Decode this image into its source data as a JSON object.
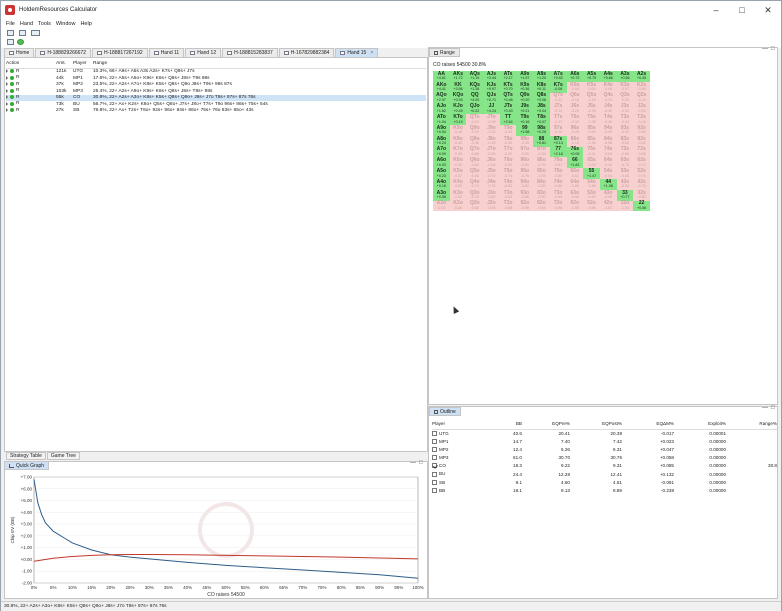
{
  "window": {
    "title": "HoldemResources Calculator"
  },
  "menu": [
    "File",
    "Hand",
    "Tools",
    "Window",
    "Help"
  ],
  "tabs": [
    {
      "label": "Home",
      "active": false
    },
    {
      "label": "H-188829266672",
      "active": false
    },
    {
      "label": "H-188817267192",
      "active": false
    },
    {
      "label": "Hand 11",
      "active": false
    },
    {
      "label": "Hand 12",
      "active": false
    },
    {
      "label": "H-188815283837",
      "active": false
    },
    {
      "label": "H-167829882384",
      "active": false
    },
    {
      "label": "Hand 15",
      "active": true
    }
  ],
  "hand_table": {
    "headers": [
      "Action",
      "Amt.",
      "Player",
      "Range"
    ],
    "rows": [
      {
        "action": "R",
        "amt": "121k",
        "player": "UTG",
        "range": "10.3%, 66+ A9s+ A5s A3s A2s+ K7s+ Q9s+ J7s",
        "selected": false
      },
      {
        "action": "R",
        "amt": "44k",
        "player": "MP1",
        "range": "17.6%, 22+ A5s+ A5o+ K9s+ K6s+ Q8s+ J8s+ T9s 88s",
        "selected": false
      },
      {
        "action": "R",
        "amt": "37k",
        "player": "MP2",
        "range": "23.5%, 22+ A2s+ A7o+ K8s+ K5s+ Q8s+ Q9o J8s+ T9s+ 98s 87s",
        "selected": false
      },
      {
        "action": "R",
        "amt": "103k",
        "player": "MP3",
        "range": "25.4%, 22+ A2s+ A9o+ K9s+ K6s+ Q8s+ J8s+ T8s+ 98s",
        "selected": false
      },
      {
        "action": "R",
        "amt": "55k",
        "player": "CO",
        "range": "30.8%, 22+ A2s+ A3o+ K8s+ K5s+ Q8s+ Q9o+ J8s+ J7o T8s+ 97s+ 87s 76s",
        "selected": true
      },
      {
        "action": "R",
        "amt": "73k",
        "player": "BU",
        "range": "56.7%, 22+ Ax+ K2s+ K8o+ Q5s+ Q8o+ J7s+ J8o+ T7s+ T9o 96s+ 86s+ 75s+ 54s",
        "selected": false
      },
      {
        "action": "R",
        "amt": "27k",
        "player": "SB",
        "range": "76.8%, 22+ Ax+ T2s+ T6o+ 92s+ 96o+ 84s+ 86o+ 75s+ 76o 63s+ 65o+ 43s",
        "selected": false
      }
    ]
  },
  "bottom_tabs": [
    "Strategy Table",
    "Game Tree"
  ],
  "quick_graph": {
    "title": "Quick Graph",
    "xlabel": "CO raises 54500",
    "ylabel": "Chip EV (BB)"
  },
  "chart_data": {
    "type": "line",
    "title": "",
    "xlabel": "CO raises 54500",
    "ylabel": "Chip EV (BB)",
    "x_ticks": [
      "0%",
      "5%",
      "10%",
      "15%",
      "20%",
      "25%",
      "30%",
      "35%",
      "40%",
      "45%",
      "50%",
      "55%",
      "60%",
      "65%",
      "70%",
      "75%",
      "80%",
      "85%",
      "90%",
      "95%",
      "100%"
    ],
    "y_ticks": [
      "+7.00",
      "+6.00",
      "+5.00",
      "+4.00",
      "+3.00",
      "+2.00",
      "+1.00",
      "+0.00",
      "-1.00",
      "-2.00"
    ],
    "ylim": [
      -2,
      7
    ],
    "series": [
      {
        "name": "",
        "color": "#2e5d88",
        "x": [
          0,
          1,
          2,
          3,
          5,
          8,
          10,
          15,
          20,
          25,
          30,
          40,
          50,
          60,
          70,
          80,
          90,
          95,
          100
        ],
        "y": [
          6.8,
          4.8,
          3.8,
          3.1,
          2.4,
          1.8,
          1.4,
          0.8,
          0.4,
          0.2,
          0.05,
          -0.25,
          -0.5,
          -0.7,
          -0.9,
          -1.1,
          -1.3,
          -1.45,
          -1.6
        ]
      },
      {
        "name": "",
        "color": "#c0392b",
        "x": [
          0,
          5,
          10,
          15,
          20,
          25,
          30,
          40,
          50,
          60,
          70,
          80,
          90,
          100
        ],
        "y": [
          -0.15,
          0.1,
          0.25,
          0.35,
          0.4,
          0.42,
          0.42,
          0.4,
          0.35,
          0.3,
          0.25,
          0.2,
          0.12,
          0.05
        ]
      }
    ],
    "grid": true
  },
  "range_panel": {
    "title": "Range",
    "subtitle": "CO raises 54500 30.8%"
  },
  "range_grid": [
    [
      "AA",
      "+4.61",
      1
    ],
    [
      "AKs",
      "+1.72",
      1
    ],
    [
      "AQs",
      "+1.19",
      1
    ],
    [
      "AJs",
      "+2.44",
      1
    ],
    [
      "ATs",
      "+2.17",
      1
    ],
    [
      "A9s",
      "+1.57",
      1
    ],
    [
      "A8s",
      "+1.20",
      1
    ],
    [
      "A7s",
      "+0.92",
      1
    ],
    [
      "A6s",
      "+0.73",
      1
    ],
    [
      "A5s",
      "+0.79",
      1
    ],
    [
      "A4s",
      "+0.66",
      1
    ],
    [
      "A3s",
      "+0.56",
      1
    ],
    [
      "A2s",
      "+0.45",
      1
    ],
    [
      "AKo",
      "+4.41",
      1
    ],
    [
      "KK",
      "+3.56",
      1
    ],
    [
      "KQs",
      "+1.36",
      1
    ],
    [
      "KJs",
      "+0.97",
      1
    ],
    [
      "KTs",
      "+0.70",
      1
    ],
    [
      "K9s",
      "+0.36",
      1
    ],
    [
      "K8s",
      "+0.11",
      1
    ],
    [
      "K7s",
      "-0.08",
      1
    ],
    [
      "K6s",
      "-0.04",
      0
    ],
    [
      "K5s",
      "-0.04",
      0
    ],
    [
      "K4s",
      "-0.06",
      0
    ],
    [
      "K3s",
      "-0.07",
      0
    ],
    [
      "K2s",
      "-0.08",
      0
    ],
    [
      "AQo",
      "+2.97",
      1
    ],
    [
      "KQo",
      "+0.93",
      1
    ],
    [
      "QQ",
      "+4.00",
      1
    ],
    [
      "QJs",
      "+0.71",
      1
    ],
    [
      "QTs",
      "+0.46",
      1
    ],
    [
      "Q9s",
      "+0.20",
      1
    ],
    [
      "Q8s",
      "+0.06",
      1
    ],
    [
      "Q7s",
      "-0.12",
      0
    ],
    [
      "Q6s",
      "-0.16",
      0
    ],
    [
      "Q5s",
      "-0.18",
      0
    ],
    [
      "Q4s",
      "-0.20",
      0
    ],
    [
      "Q3s",
      "-0.22",
      0
    ],
    [
      "Q2s",
      "-0.24",
      0
    ],
    [
      "AJo",
      "+1.62",
      1
    ],
    [
      "KJo",
      "+0.49",
      1
    ],
    [
      "QJo",
      "+0.22",
      1
    ],
    [
      "JJ",
      "+4.24",
      1
    ],
    [
      "JTs",
      "+0.43",
      1
    ],
    [
      "J9s",
      "+0.21",
      1
    ],
    [
      "J8s",
      "+0.04",
      1
    ],
    [
      "J7s",
      "-0.14",
      0
    ],
    [
      "J6s",
      "-0.25",
      0
    ],
    [
      "J5s",
      "-0.28",
      0
    ],
    [
      "J4s",
      "-0.30",
      0
    ],
    [
      "J3s",
      "-0.31",
      0
    ],
    [
      "J2s",
      "-0.33",
      0
    ],
    [
      "ATo",
      "+1.04",
      1
    ],
    [
      "KTo",
      "+0.19",
      1
    ],
    [
      "QTo",
      "-0.03",
      0
    ],
    [
      "JTo",
      "-0.08",
      0
    ],
    [
      "TT",
      "+2.64",
      1
    ],
    [
      "T9s",
      "+0.16",
      1
    ],
    [
      "T8s",
      "+0.07",
      1
    ],
    [
      "T7s",
      "-0.17",
      0
    ],
    [
      "T6s",
      "-0.30",
      0
    ],
    [
      "T5s",
      "-0.38",
      0
    ],
    [
      "T4s",
      "-0.40",
      0
    ],
    [
      "T3s",
      "-0.42",
      0
    ],
    [
      "T2s",
      "-0.44",
      0
    ],
    [
      "A9o",
      "+0.54",
      1
    ],
    [
      "K9o",
      "-0.18",
      0
    ],
    [
      "Q9o",
      "-0.29",
      0
    ],
    [
      "J9o",
      "-0.32",
      0
    ],
    [
      "T9o",
      "-0.34",
      0
    ],
    [
      "99",
      "+1.58",
      1
    ],
    [
      "98s",
      "+0.25",
      1
    ],
    [
      "97s",
      "-0.10",
      0
    ],
    [
      "96s",
      "-0.28",
      0
    ],
    [
      "95s",
      "-0.46",
      0
    ],
    [
      "94s",
      "-0.50",
      0
    ],
    [
      "93s",
      "-0.53",
      0
    ],
    [
      "92s",
      "-0.56",
      0
    ],
    [
      "A8o",
      "+0.24",
      1
    ],
    [
      "K8o",
      "-0.40",
      0
    ],
    [
      "Q8o",
      "-0.46",
      0
    ],
    [
      "J8o",
      "-0.48",
      0
    ],
    [
      "T8o",
      "-0.40",
      0
    ],
    [
      "98o",
      "-0.40",
      0
    ],
    [
      "88",
      "+0.81",
      1
    ],
    [
      "87s",
      "+0.14",
      1
    ],
    [
      "86s",
      "-0.19",
      0
    ],
    [
      "85s",
      "-0.36",
      0
    ],
    [
      "84s",
      "-0.58",
      0
    ],
    [
      "83s",
      "-0.60",
      0
    ],
    [
      "82s",
      "-0.62",
      0
    ],
    [
      "A7o",
      "+0.09",
      1
    ],
    [
      "K7o",
      "-0.45",
      0
    ],
    [
      "Q7o",
      "-0.56",
      0
    ],
    [
      "J7o",
      "-0.56",
      0
    ],
    [
      "T7o",
      "-0.52",
      0
    ],
    [
      "97o",
      "-0.50",
      0
    ],
    [
      "87o",
      "-0.58",
      0
    ],
    [
      "77",
      "+2.18",
      1
    ],
    [
      "76s",
      "+0.05",
      1
    ],
    [
      "75s",
      "-0.31",
      0
    ],
    [
      "74s",
      "-0.64",
      0
    ],
    [
      "73s",
      "-0.66",
      0
    ],
    [
      "72s",
      "-0.68",
      0
    ],
    [
      "A6o",
      "+0.03",
      1
    ],
    [
      "K6o",
      "-0.52",
      0
    ],
    [
      "Q6o",
      "-0.62",
      0
    ],
    [
      "J6o",
      "-0.64",
      0
    ],
    [
      "T6o",
      "-0.62",
      0
    ],
    [
      "96o",
      "-0.60",
      0
    ],
    [
      "86o",
      "-0.70",
      0
    ],
    [
      "76o",
      "-0.67",
      0
    ],
    [
      "66",
      "+1.82",
      1
    ],
    [
      "65s",
      "-0.03",
      0
    ],
    [
      "64s",
      "-0.40",
      0
    ],
    [
      "63s",
      "-0.70",
      0
    ],
    [
      "62s",
      "-0.72",
      0
    ],
    [
      "A5o",
      "+0.23",
      1
    ],
    [
      "K5o",
      "-0.57",
      0
    ],
    [
      "Q5o",
      "-0.66",
      0
    ],
    [
      "J5o",
      "-0.72",
      0
    ],
    [
      "T5o",
      "-0.74",
      0
    ],
    [
      "95o",
      "-0.76",
      0
    ],
    [
      "85o",
      "-0.78",
      0
    ],
    [
      "75o",
      "-0.80",
      0
    ],
    [
      "65o",
      "-0.82",
      0
    ],
    [
      "55",
      "+1.47",
      1
    ],
    [
      "54s",
      "-0.04",
      0
    ],
    [
      "53s",
      "-0.45",
      0
    ],
    [
      "52s",
      "-0.74",
      0
    ],
    [
      "A4o",
      "+0.18",
      1
    ],
    [
      "K4o",
      "-0.59",
      0
    ],
    [
      "Q4o",
      "-0.74",
      0
    ],
    [
      "J4o",
      "-0.76",
      0
    ],
    [
      "T4o",
      "-0.80",
      0
    ],
    [
      "94o",
      "-0.82",
      0
    ],
    [
      "84o",
      "-0.85",
      0
    ],
    [
      "74o",
      "-0.88",
      0
    ],
    [
      "64o",
      "-0.89",
      0
    ],
    [
      "54o",
      "-0.86",
      0
    ],
    [
      "44",
      "+1.08",
      1
    ],
    [
      "43s",
      "-0.50",
      0
    ],
    [
      "42s",
      "-0.78",
      0
    ],
    [
      "A3o",
      "+0.08",
      1
    ],
    [
      "K3o",
      "-0.62",
      0
    ],
    [
      "Q3o",
      "-0.78",
      0
    ],
    [
      "J3o",
      "-0.80",
      0
    ],
    [
      "T3o",
      "-0.84",
      0
    ],
    [
      "93o",
      "-0.86",
      0
    ],
    [
      "83o",
      "-0.90",
      0
    ],
    [
      "73o",
      "-0.93",
      0
    ],
    [
      "63o",
      "-0.96",
      0
    ],
    [
      "53o",
      "-0.92",
      0
    ],
    [
      "43o",
      "-0.96",
      0
    ],
    [
      "33",
      "+0.77",
      1
    ],
    [
      "32s",
      "-0.80",
      0
    ],
    [
      "A2o",
      "-0.03",
      0
    ],
    [
      "K2o",
      "-0.66",
      0
    ],
    [
      "Q2o",
      "-0.82",
      0
    ],
    [
      "J2o",
      "-0.84",
      0
    ],
    [
      "T2o",
      "-0.88",
      0
    ],
    [
      "92o",
      "-0.90",
      0
    ],
    [
      "82o",
      "-0.94",
      0
    ],
    [
      "72o",
      "-0.98",
      0
    ],
    [
      "62o",
      "-1.00",
      0
    ],
    [
      "52o",
      "-0.98",
      0
    ],
    [
      "42o",
      "-1.02",
      0
    ],
    [
      "32o",
      "-1.04",
      0
    ],
    [
      "22",
      "+0.56",
      1
    ]
  ],
  "outline": {
    "title": "Outline",
    "headers": [
      "Player",
      "BB",
      "EQPre%",
      "EQPost%",
      "EQΔM%",
      "Exploit%",
      "Range%"
    ],
    "rows": [
      {
        "player": "UTG",
        "bb": "40.6",
        "eqpre": "20.41",
        "eqpost": "20.39",
        "eqdelta": "-0.017",
        "exploit": "0.00001",
        "range": "",
        "checked": false
      },
      {
        "player": "MP1",
        "bb": "14.7",
        "eqpre": "7.40",
        "eqpost": "7.42",
        "eqdelta": "+0.023",
        "exploit": "0.00000",
        "range": "",
        "checked": false
      },
      {
        "player": "MP2",
        "bb": "12.4",
        "eqpre": "6.26",
        "eqpost": "6.31",
        "eqdelta": "+0.047",
        "exploit": "0.00000",
        "range": "",
        "checked": false
      },
      {
        "player": "MP3",
        "bb": "61.0",
        "eqpre": "30.70",
        "eqpost": "30.76",
        "eqdelta": "+0.058",
        "exploit": "0.00000",
        "range": "",
        "checked": false
      },
      {
        "player": "CO",
        "bb": "18.3",
        "eqpre": "9.22",
        "eqpost": "9.31",
        "eqdelta": "+0.085",
        "exploit": "0.00000",
        "range": "30.8",
        "checked": true
      },
      {
        "player": "BU",
        "bb": "24.4",
        "eqpre": "12.28",
        "eqpost": "12.41",
        "eqdelta": "+0.132",
        "exploit": "0.00000",
        "range": "",
        "checked": false
      },
      {
        "player": "SB",
        "bb": "9.1",
        "eqpre": "4.60",
        "eqpost": "4.51",
        "eqdelta": "-0.091",
        "exploit": "0.00000",
        "range": "",
        "checked": false
      },
      {
        "player": "BB",
        "bb": "18.1",
        "eqpre": "9.13",
        "eqpost": "8.89",
        "eqdelta": "-0.238",
        "exploit": "0.00000",
        "range": "",
        "checked": false
      }
    ]
  },
  "status_bar": {
    "text": "30.8%, 22+ A2s+ A3o+ K8s+ K5s+ Q8s+ Q9o+ J8s+ J7o T8s+ 97s+ 87s 76s"
  },
  "colors": {
    "in_range": "#86e489",
    "out_range": "#f9d0d0",
    "selection": "#cde0f4"
  }
}
